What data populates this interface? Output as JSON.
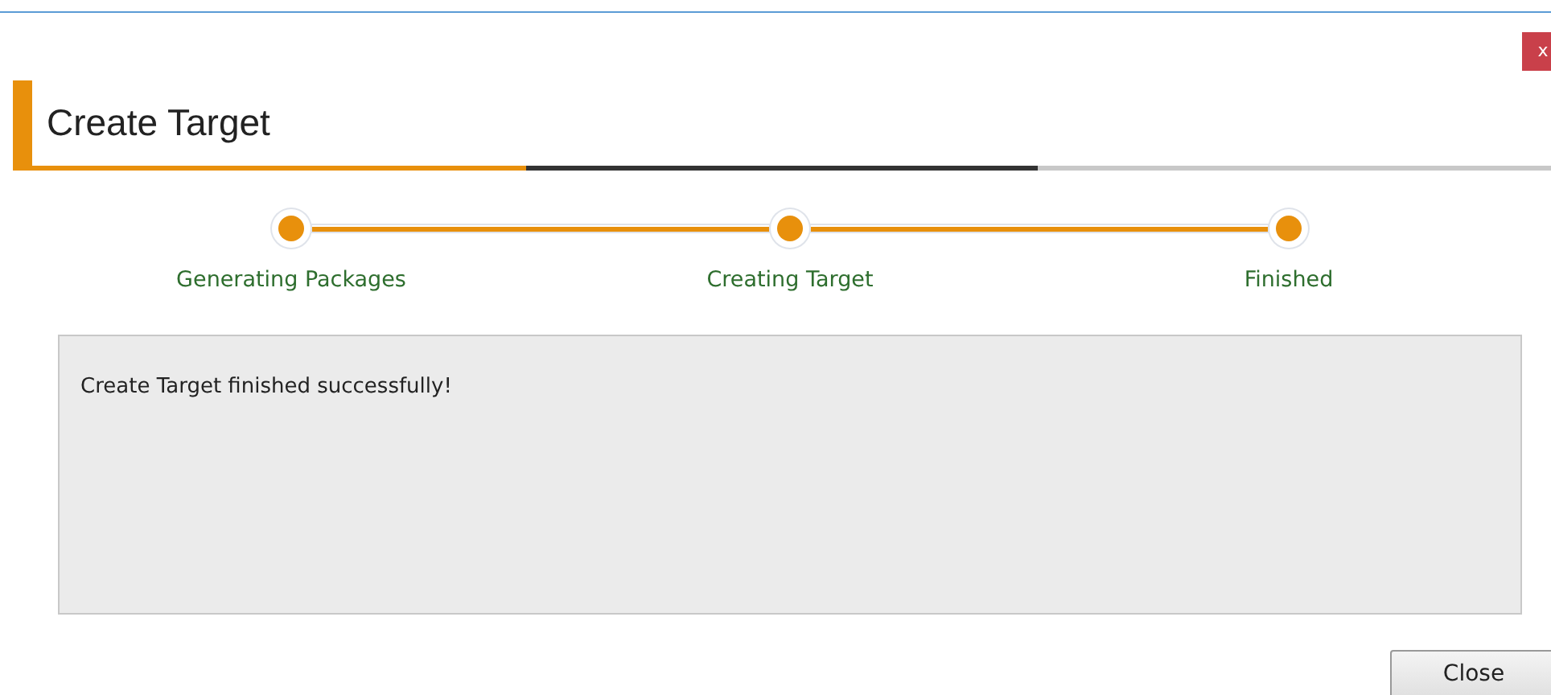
{
  "close_x": "x",
  "title": "Create Target",
  "steps": [
    {
      "label": "Generating Packages",
      "completed": true
    },
    {
      "label": "Creating Target",
      "completed": true
    },
    {
      "label": "Finished",
      "completed": true
    }
  ],
  "message": "Create Target finished successfully!",
  "buttons": [
    "Close"
  ]
}
